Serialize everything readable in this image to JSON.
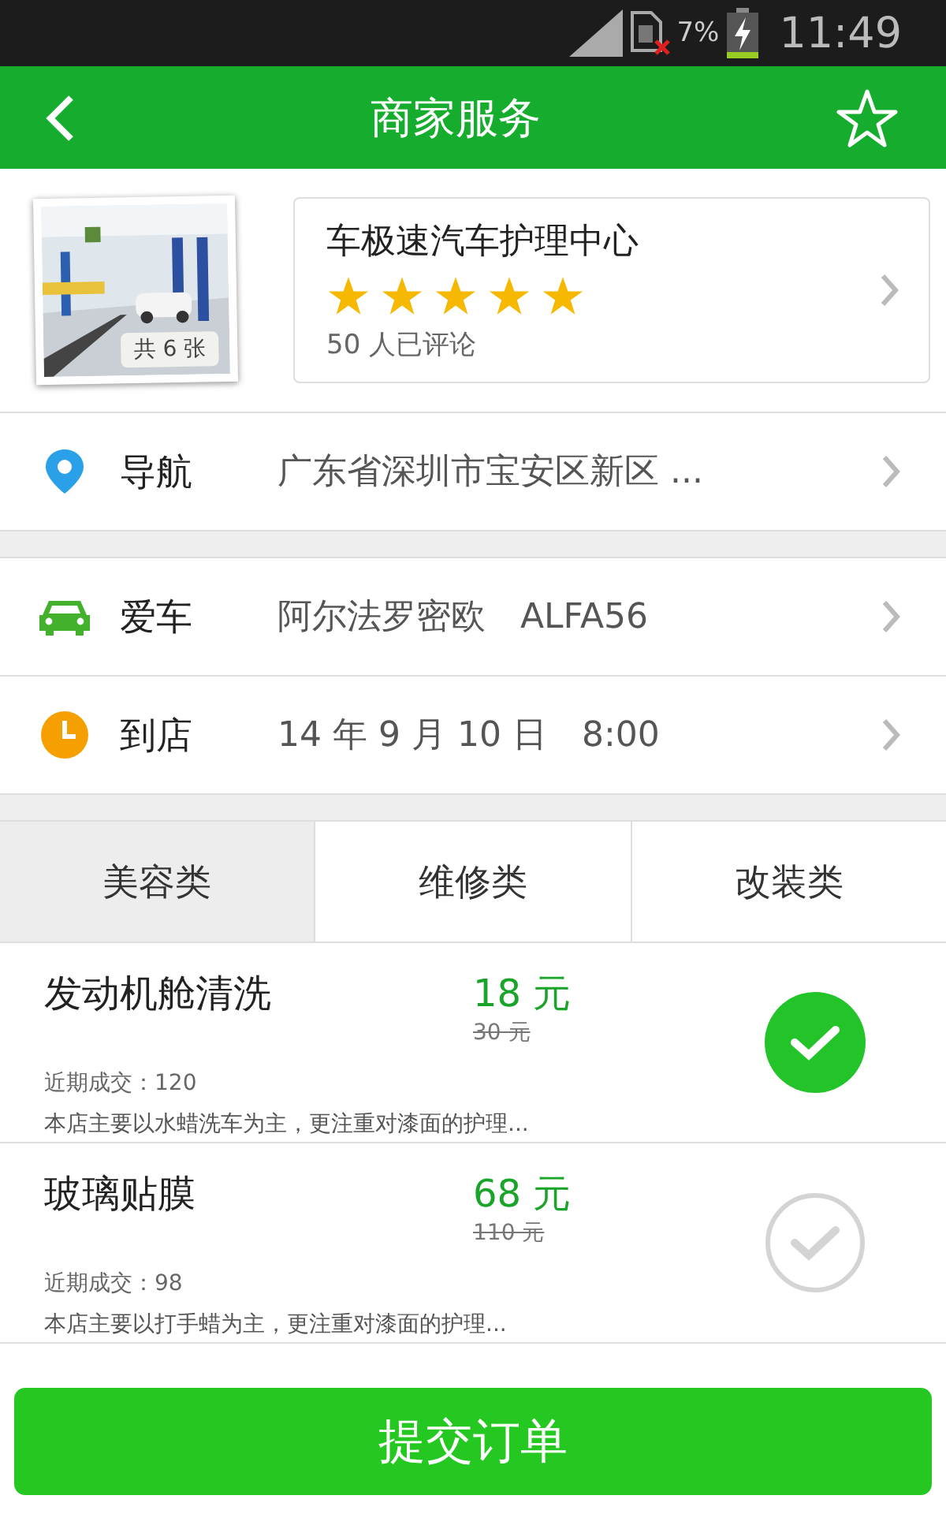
{
  "status_bar": {
    "battery": "7%",
    "time": "11:49"
  },
  "header": {
    "title": "商家服务",
    "favorited": false
  },
  "shop": {
    "photo_count": "共 6 张",
    "name": "车极速汽车护理中心",
    "stars": 5,
    "reviews": "50 人已评论"
  },
  "info_groups": [
    [
      {
        "kind": "location",
        "label": "导航",
        "value": "广东省深圳市宝安区新区 ..."
      }
    ],
    [
      {
        "kind": "car",
        "label": "爱车",
        "value": "阿尔法罗密欧　ALFA56"
      },
      {
        "kind": "clock",
        "label": "到店",
        "value": "14 年 9 月 10 日　8:00"
      }
    ]
  ],
  "tabs": [
    {
      "label": "美容类",
      "selected": true
    },
    {
      "label": "维修类",
      "selected": false
    },
    {
      "label": "改装类",
      "selected": false
    }
  ],
  "services": [
    {
      "name": "发动机舱清洗",
      "price": "18 元",
      "original_price": "30 元",
      "sales": "近期成交：120",
      "description": "本店主要以水蜡洗车为主，更注重对漆面的护理...",
      "selected": true
    },
    {
      "name": "玻璃贴膜",
      "price": "68 元",
      "original_price": "110 元",
      "sales": "近期成交：98",
      "description": "本店主要以打手蜡为主，更注重对漆面的护理...",
      "selected": false
    }
  ],
  "submit_button": "提交订单"
}
